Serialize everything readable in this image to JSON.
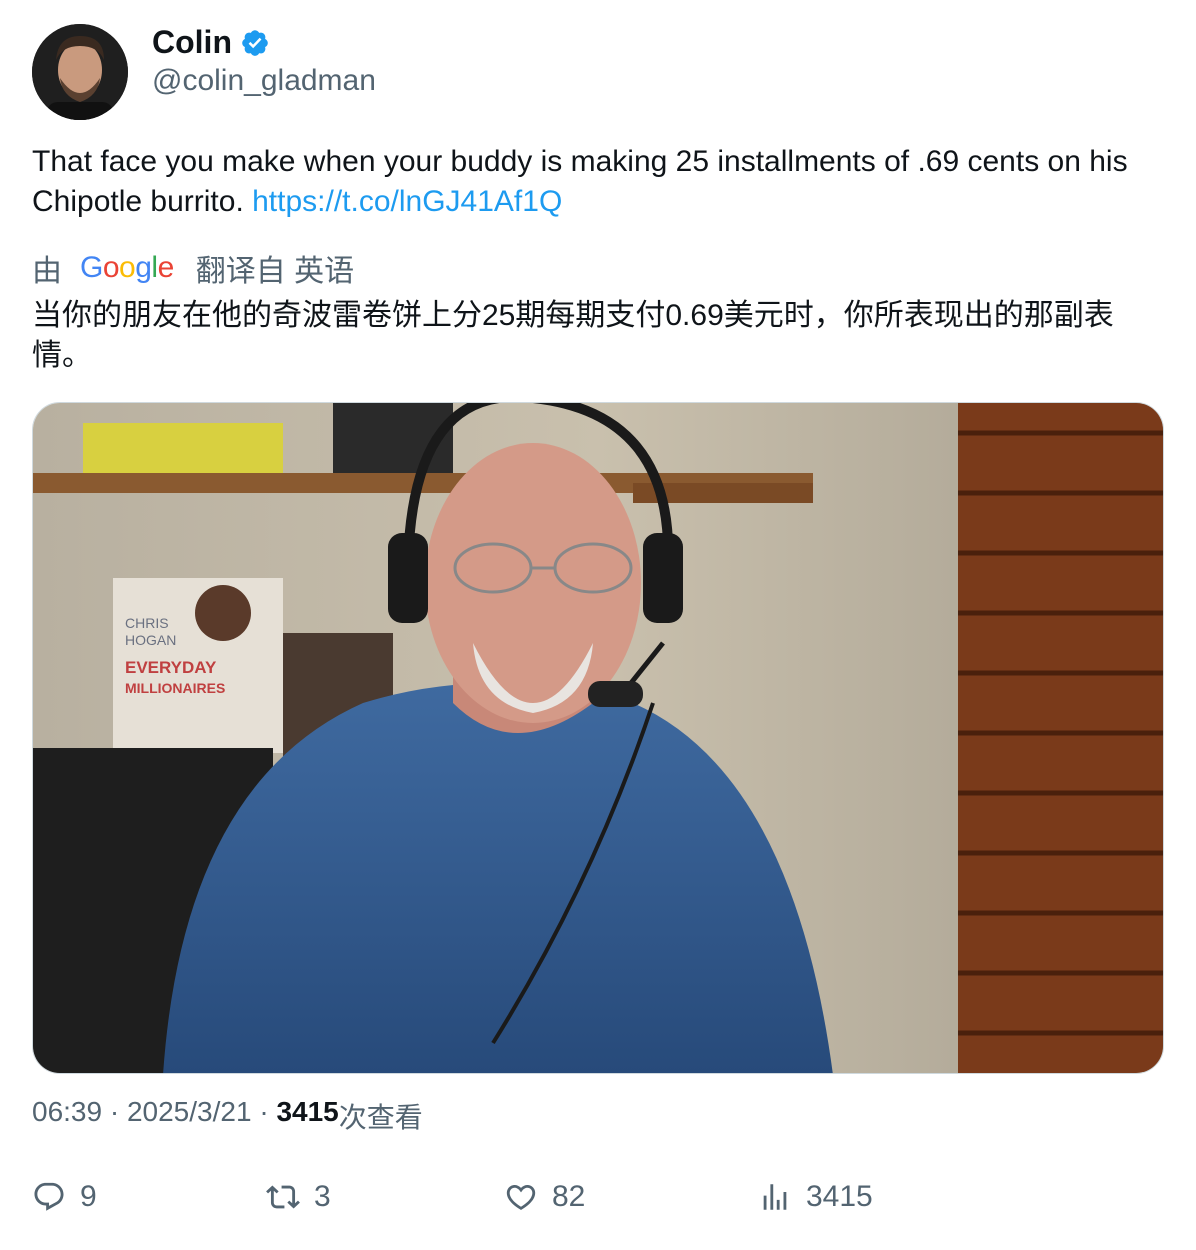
{
  "author": {
    "name": "Colin",
    "handle": "@colin_gladman",
    "verified": true
  },
  "tweet": {
    "text": "That face you make when your buddy is making 25 installments of .69 cents on his Chipotle burrito.",
    "link": "https://t.co/lnGJ41Af1Q"
  },
  "translation": {
    "by_label": "由",
    "provider": "Google",
    "from_label": "翻译自 英语",
    "text": "当你的朋友在他的奇波雷卷饼上分25期每期支付0.69美元时，你所表现出的那副表情。"
  },
  "media": {
    "book_lines": [
      "CHRIS",
      "HOGAN",
      "EVERYDAY",
      "MILLIONAIRES"
    ]
  },
  "meta": {
    "time": "06:39",
    "date": "2025/3/21",
    "sep": " · ",
    "views_count": "3415",
    "views_label": "次查看"
  },
  "actions": {
    "replies": "9",
    "retweets": "3",
    "likes": "82",
    "views": "3415"
  },
  "colors": {
    "link": "#1d9bf0",
    "secondary_text": "#536471",
    "verified": "#1d9bf0"
  },
  "icons": [
    "verified-badge-icon",
    "google-logo",
    "reply-icon",
    "retweet-icon",
    "like-icon",
    "views-icon"
  ]
}
